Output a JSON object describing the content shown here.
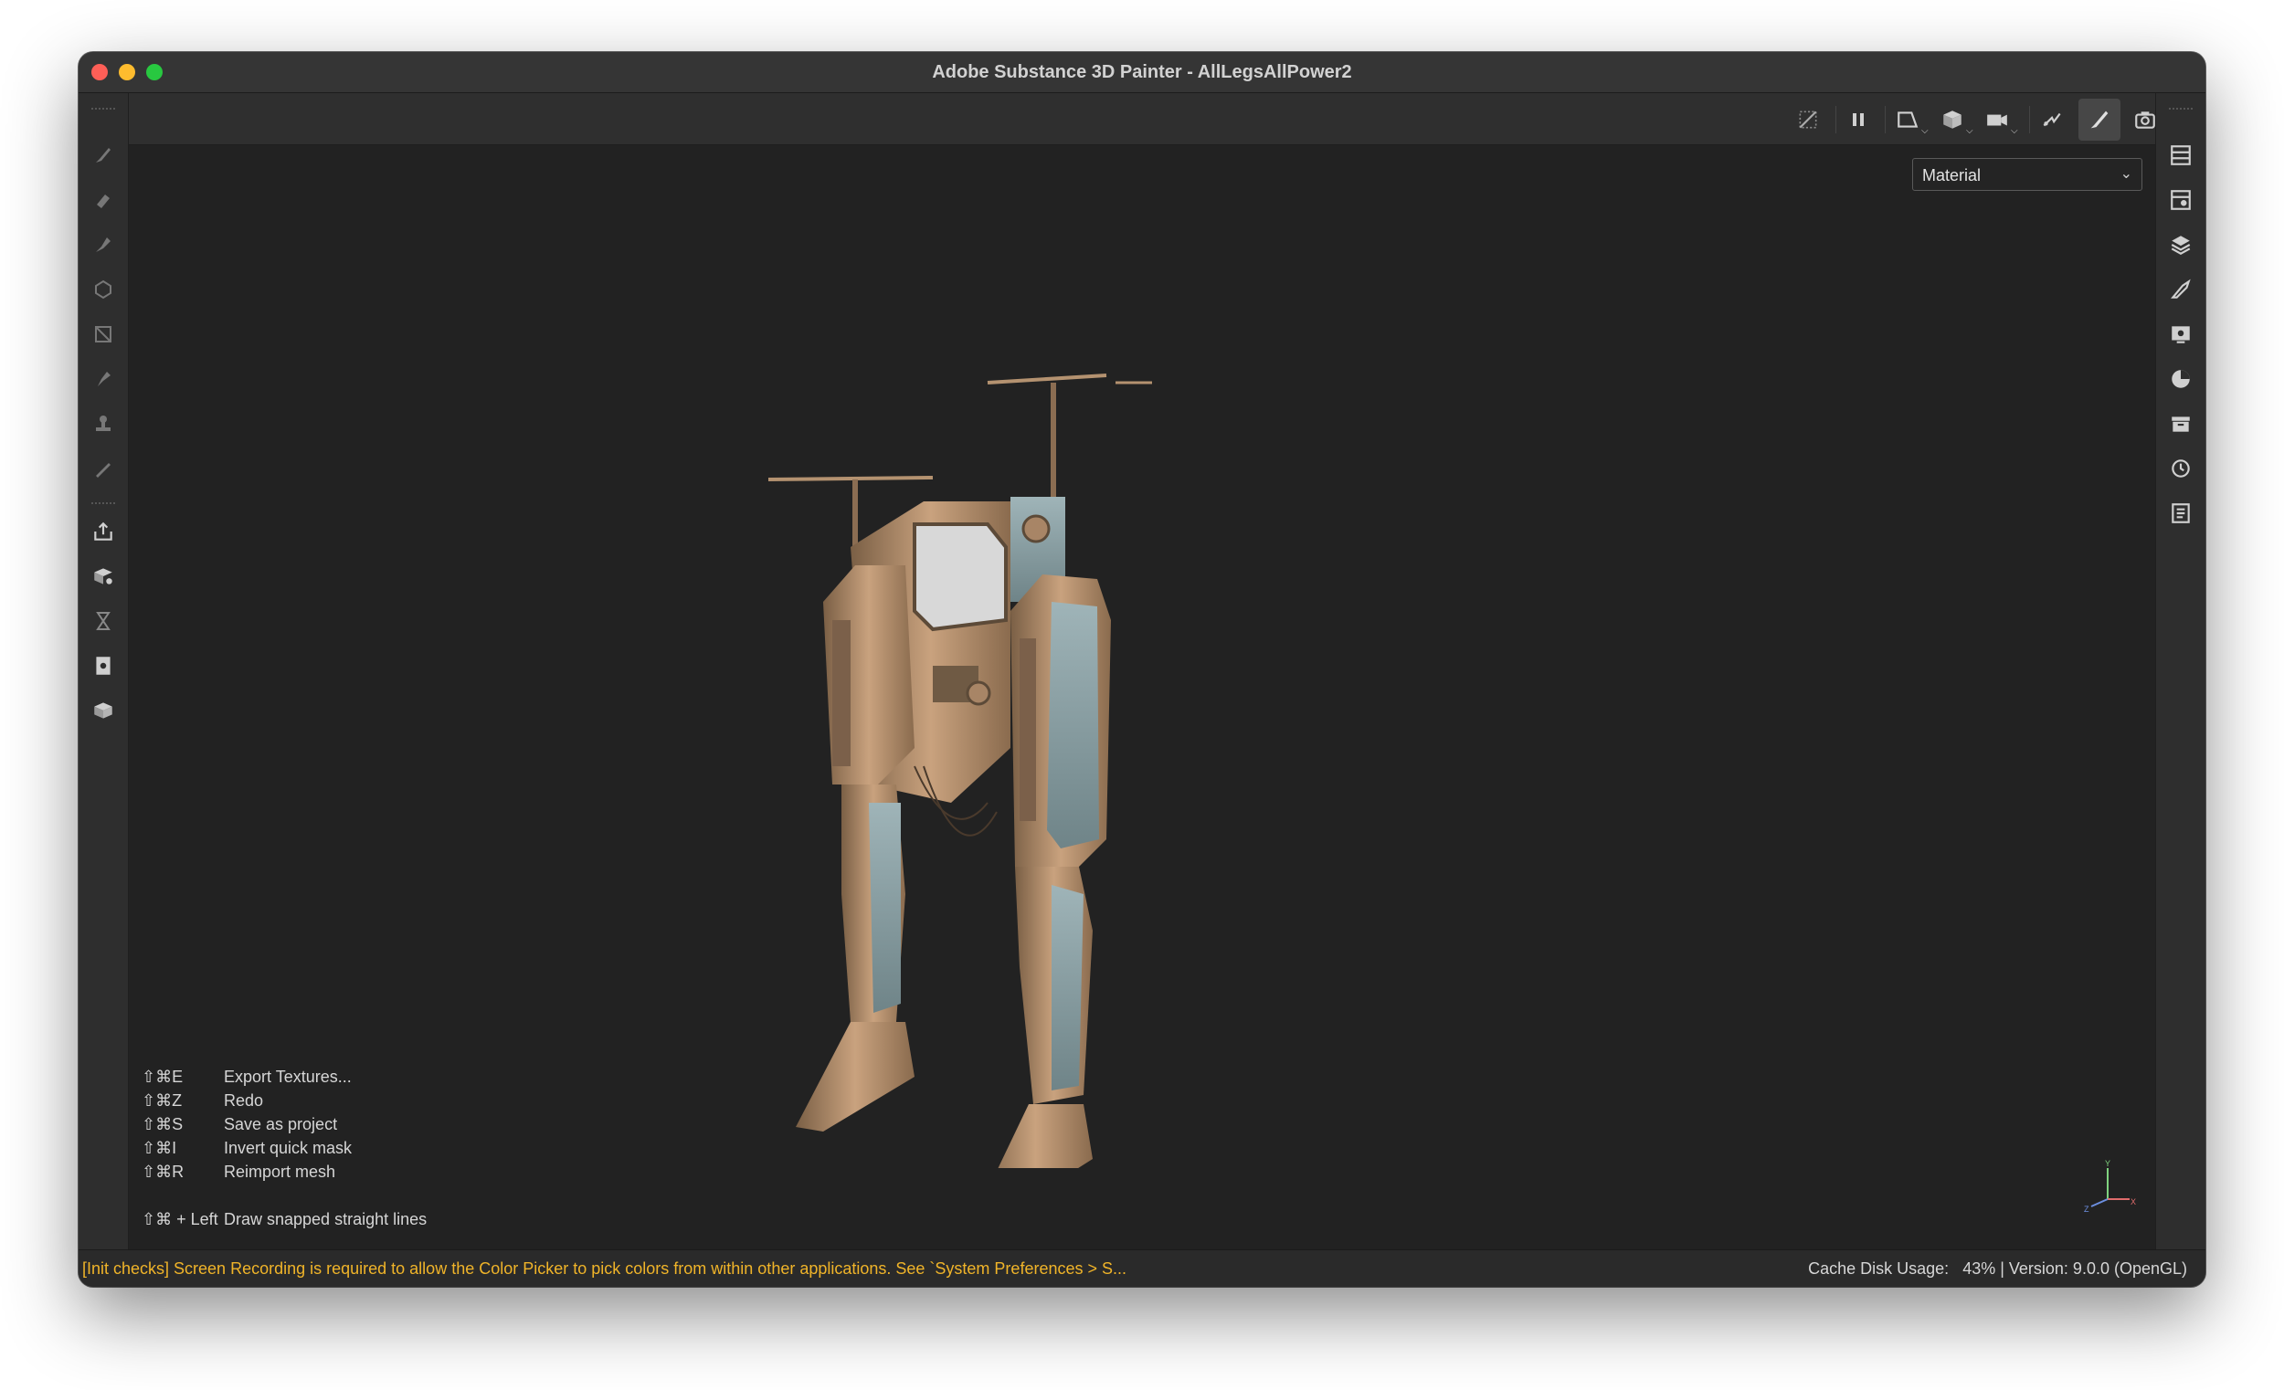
{
  "window": {
    "title": "Adobe Substance 3D Painter - AllLegsAllPower2"
  },
  "left_toolbar": {
    "tools": [
      {
        "icon": "paint-brush-icon"
      },
      {
        "icon": "eraser-icon"
      },
      {
        "icon": "projection-icon"
      },
      {
        "icon": "geometry-mask-icon"
      },
      {
        "icon": "polygon-fill-icon"
      },
      {
        "icon": "smudge-icon"
      },
      {
        "icon": "clone-stamp-icon"
      },
      {
        "icon": "color-picker-icon"
      },
      {
        "icon": "export-icon"
      },
      {
        "icon": "bake-icon"
      },
      {
        "icon": "hourglass-icon"
      },
      {
        "icon": "document-search-icon"
      },
      {
        "icon": "box-icon"
      }
    ]
  },
  "top_toolbar": {
    "icons": [
      "hide-icon",
      "pause-icon",
      "view-mode-icon",
      "cube-icon",
      "camera-icon",
      "symmetry-icon",
      "paint-mode-icon",
      "screenshot-icon"
    ]
  },
  "viewport": {
    "channel_dropdown": {
      "value": "Material"
    },
    "shortcuts": [
      {
        "key": "⇧⌘E",
        "label": "Export Textures..."
      },
      {
        "key": "⇧⌘Z",
        "label": "Redo"
      },
      {
        "key": "⇧⌘S",
        "label": "Save as project"
      },
      {
        "key": "⇧⌘I",
        "label": "Invert quick mask"
      },
      {
        "key": "⇧⌘R",
        "label": "Reimport mesh"
      }
    ],
    "mouse_shortcut": {
      "key": "⇧⌘ + Left",
      "label": "Draw snapped straight lines"
    },
    "gizmo": {
      "y": "Y",
      "x": "X",
      "z": "Z"
    }
  },
  "right_toolbar": {
    "icons": [
      "layers-list-icon",
      "texture-set-icon",
      "layers-icon",
      "properties-icon",
      "display-settings-icon",
      "shader-icon",
      "assets-icon",
      "history-icon",
      "log-icon"
    ]
  },
  "status_bar": {
    "message": "[Init checks] Screen Recording is required to allow the Color Picker to pick colors from within other applications. See `System Preferences > S...",
    "cache_label": "Cache Disk Usage:",
    "cache_value": "43% | Version: 9.0.0 (OpenGL)"
  },
  "colors": {
    "warning": "#f0b429",
    "background": "#222222",
    "toolbar": "#2e2e2e"
  }
}
